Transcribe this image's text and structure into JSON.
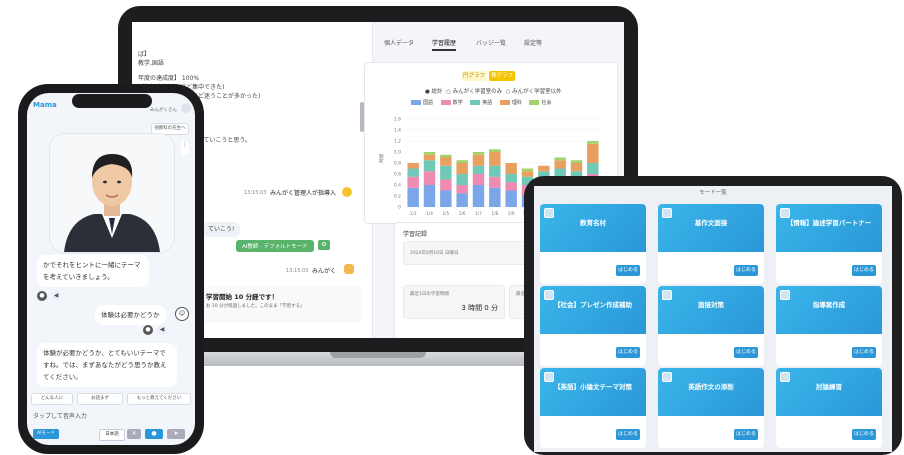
{
  "laptop": {
    "chat": {
      "lines": [
        "ば】",
        "教学,国語",
        "年度の達成度】 100%",
        "( 数字が大きい ほど集中できた)",
        "学習（数字が小さいほど迷うことが多かった)",
        "ぎてき？",
        "もして　 ⌘1で用紙にしていこうと思う。"
      ],
      "message_1_time": "13:15:03",
      "message_1_user": "みんがく管理人が指導入",
      "message_2": "ていこう!",
      "green_button": "AI教師 · デフォルトモード",
      "message_3_time": "13:15:03",
      "message_3_user": "みんがく",
      "message_4_title": "学習開始 10 分経です！",
      "message_4_body": "お 10 分が経過しました。このまま「学習する」"
    },
    "tabs": [
      "個人データ",
      "学習履歴",
      "バッジ一覧",
      "設定等"
    ],
    "graph": {
      "toggle_1": "円グラフ",
      "toggle_2": "棒グラフ",
      "radio": [
        "● 総計",
        "○ みんがく学習室のみ",
        "○ みんがく学習室以外"
      ],
      "legend_colors": [
        "#7ba7e8",
        "#ef8ab1",
        "#6fc9b6",
        "#e8a060",
        "#a3d26b"
      ]
    },
    "record": {
      "title": "学習記録",
      "box_1": "2024年6月10日 日曜日",
      "box_2_label": "最近1日の学習時間",
      "box_2_value": "3 時間 0 分",
      "box_3_label": "最近1週の学習時間"
    }
  },
  "phone": {
    "app_name": "Mama",
    "status_right": "みんがくさん",
    "top_button": "他教科の先生へ",
    "bubble_1": "かでそれをヒントに一緒にテーマを考えていきましょう。",
    "bubble_2": "体験は必要かどうか",
    "bubble_3": "体験が必要かどうか、とてもいいテーマですね。では、まずあなたがどう思うか教えてください。",
    "quick_replies": [
      "どんな人に",
      "お話まず",
      "もっと教えてください"
    ],
    "input_placeholder": "タップして音声入力",
    "model_badge": "AIモード",
    "lang_select": "日本語"
  },
  "tablet": {
    "header": "モード一覧",
    "cards": [
      {
        "title": "教育名村",
        "button": "はじめる"
      },
      {
        "title": "基作文面接",
        "button": "はじめる"
      },
      {
        "title": "【情報】論述学習パートナー",
        "button": "はじめる"
      },
      {
        "title": "【社会】プレゼン作成補助",
        "button": "はじめる"
      },
      {
        "title": "面接対策",
        "button": "はじめる"
      },
      {
        "title": "指導案作成",
        "button": "はじめる"
      },
      {
        "title": "【英語】小論文テーマ対策",
        "button": "はじめる"
      },
      {
        "title": "英語作文の添削",
        "button": "はじめる"
      },
      {
        "title": "討論練習",
        "button": "はじめる"
      }
    ]
  },
  "chart_data": {
    "type": "bar",
    "stacked": true,
    "categories": [
      "1/3",
      "1/4",
      "1/5",
      "1/6",
      "1/7",
      "1/8",
      "1/9",
      "1/10",
      "1/11",
      "1/12",
      "1/13",
      "1/14"
    ],
    "ylabel": "時間",
    "ylim": [
      0,
      1.6
    ],
    "yticks": [
      "0",
      "0.2",
      "0.4",
      "0.6",
      "0.8",
      "1.0",
      "1.2",
      "1.4",
      "1.6"
    ],
    "series": [
      {
        "name": "国語",
        "color": "#7ba7e8",
        "values": [
          0.35,
          0.4,
          0.3,
          0.25,
          0.4,
          0.35,
          0.3,
          0.2,
          0.3,
          0.35,
          0.3,
          0.4
        ]
      },
      {
        "name": "数学",
        "color": "#ef8ab1",
        "values": [
          0.2,
          0.25,
          0.2,
          0.15,
          0.2,
          0.2,
          0.15,
          0.2,
          0.15,
          0.2,
          0.15,
          0.2
        ]
      },
      {
        "name": "英語",
        "color": "#6fc9b6",
        "values": [
          0.15,
          0.2,
          0.25,
          0.2,
          0.15,
          0.2,
          0.15,
          0.15,
          0.2,
          0.15,
          0.2,
          0.2
        ]
      },
      {
        "name": "理科",
        "color": "#e8a060",
        "values": [
          0.1,
          0.1,
          0.15,
          0.2,
          0.2,
          0.25,
          0.2,
          0.1,
          0.1,
          0.15,
          0.15,
          0.35
        ]
      },
      {
        "name": "社会",
        "color": "#a3d26b",
        "values": [
          0.0,
          0.05,
          0.05,
          0.05,
          0.05,
          0.05,
          0.0,
          0.05,
          0.0,
          0.05,
          0.05,
          0.05
        ]
      }
    ]
  }
}
